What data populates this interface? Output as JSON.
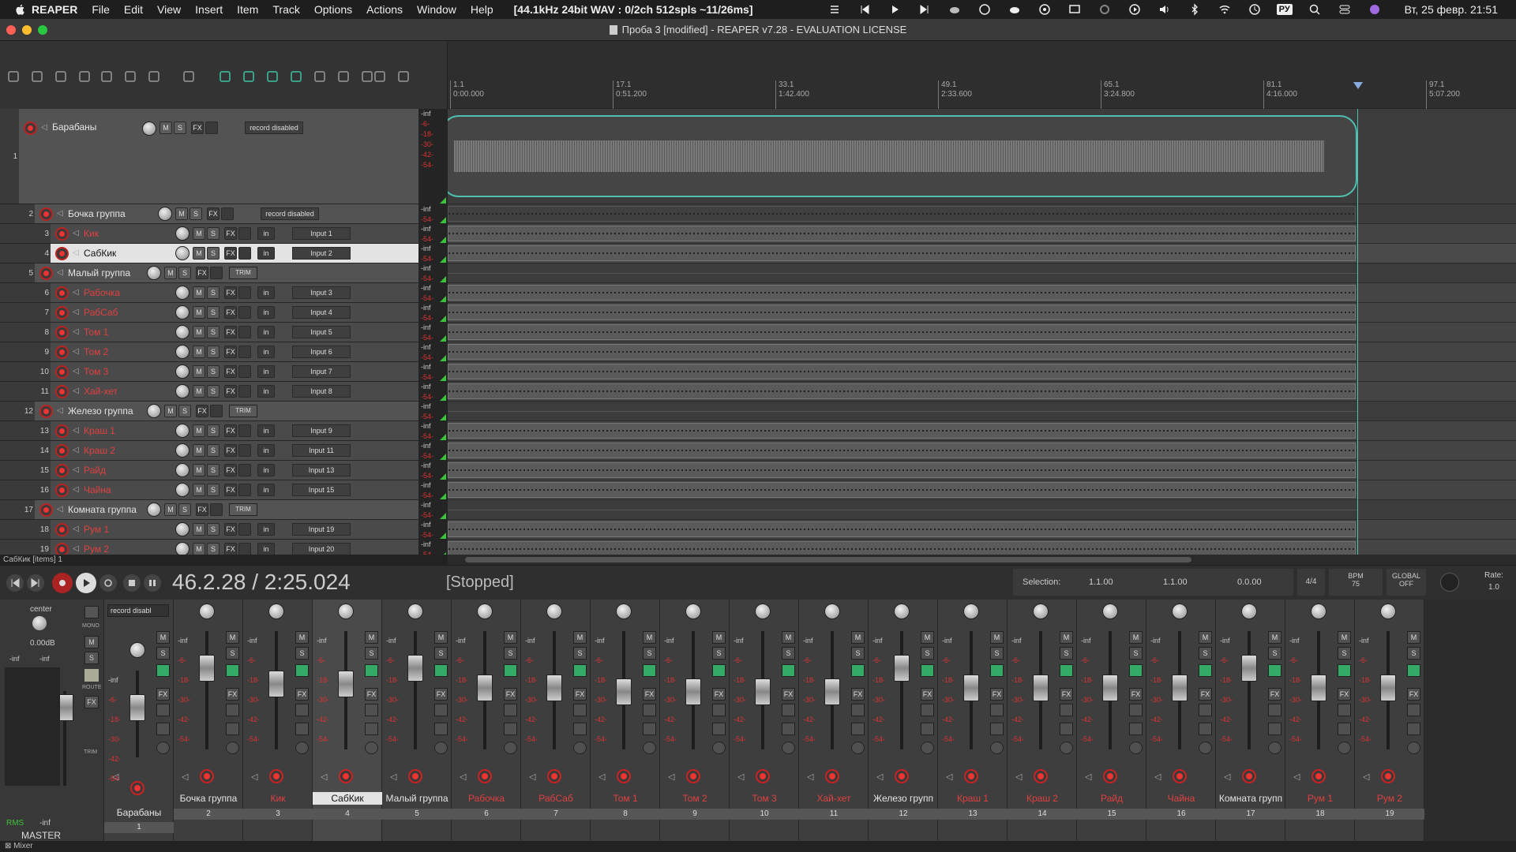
{
  "menubar": {
    "app": "REAPER",
    "items": [
      "File",
      "Edit",
      "View",
      "Insert",
      "Item",
      "Track",
      "Options",
      "Actions",
      "Window",
      "Help"
    ],
    "status": "[44.1kHz 24bit WAV : 0/2ch 512spls ~11/26ms]",
    "lang": "РУ",
    "clock": "Вт, 25 февр.  21:51"
  },
  "window": {
    "title": "Проба 3 [modified] - REAPER v7.28 - EVALUATION LICENSE"
  },
  "ruler": {
    "marks": [
      {
        "bar": "1.1",
        "time": "0:00.000"
      },
      {
        "bar": "17.1",
        "time": "0:51.200"
      },
      {
        "bar": "33.1",
        "time": "1:42.400"
      },
      {
        "bar": "49.1",
        "time": "2:33.600"
      },
      {
        "bar": "65.1",
        "time": "3:24.800"
      },
      {
        "bar": "81.1",
        "time": "4:16.000"
      },
      {
        "bar": "97.1",
        "time": "5:07.200"
      }
    ]
  },
  "tracks": [
    {
      "num": "1",
      "name": "Барабаны",
      "type": "folder",
      "input": "record disabled"
    },
    {
      "num": "2",
      "name": "Бочка группа",
      "type": "folder",
      "input": "record disabled"
    },
    {
      "num": "3",
      "name": "Кик",
      "type": "track",
      "input": "Input 1"
    },
    {
      "num": "4",
      "name": "СабКик",
      "type": "track",
      "input": "Input 2",
      "selected": true
    },
    {
      "num": "5",
      "name": "Малый группа",
      "type": "folder",
      "input": ""
    },
    {
      "num": "6",
      "name": "Рабочка",
      "type": "track",
      "input": "Input 3"
    },
    {
      "num": "7",
      "name": "РабСаб",
      "type": "track",
      "input": "Input 4"
    },
    {
      "num": "8",
      "name": "Том 1",
      "type": "track",
      "input": "Input 5"
    },
    {
      "num": "9",
      "name": "Том 2",
      "type": "track",
      "input": "Input 6"
    },
    {
      "num": "10",
      "name": "Том 3",
      "type": "track",
      "input": "Input 7"
    },
    {
      "num": "11",
      "name": "Хай-хет",
      "type": "track",
      "input": "Input 8"
    },
    {
      "num": "12",
      "name": "Железо группа",
      "type": "folder",
      "input": ""
    },
    {
      "num": "13",
      "name": "Краш 1",
      "type": "track",
      "input": "Input 9"
    },
    {
      "num": "14",
      "name": "Краш 2",
      "type": "track",
      "input": "Input 11"
    },
    {
      "num": "15",
      "name": "Райд",
      "type": "track",
      "input": "Input 13"
    },
    {
      "num": "16",
      "name": "Чайна",
      "type": "track",
      "input": "Input 15"
    },
    {
      "num": "17",
      "name": "Комната группа",
      "type": "folder",
      "input": ""
    },
    {
      "num": "18",
      "name": "Рум 1",
      "type": "track",
      "input": "Input 19"
    },
    {
      "num": "19",
      "name": "Рум 2",
      "type": "track",
      "input": "Input 20"
    }
  ],
  "labels": {
    "mute": "M",
    "solo": "S",
    "fx": "FX",
    "in": "in",
    "trim": "TRIM",
    "inf": "-inf",
    "m6": "-6-",
    "m18": "-18-",
    "m30": "-30-",
    "m42": "-42-",
    "m54": "-54-"
  },
  "statusline": "СабКик [items] 1",
  "transport": {
    "time": "46.2.28 / 2:25.024",
    "state": "[Stopped]",
    "selection_label": "Selection:",
    "sel_start": "1.1.00",
    "sel_end": "1.1.00",
    "sel_len": "0.0.00",
    "timesig": "4/4",
    "bpm_label": "BPM",
    "bpm": "75",
    "global_label": "GLOBAL",
    "global_value": "OFF",
    "rate_label": "Rate:",
    "rate": "1.0"
  },
  "mixer": {
    "master_label": "MASTER",
    "center": "center",
    "volume": "0.00dB",
    "rms": "RMS",
    "rms_val": "-inf",
    "mono": "MONO",
    "route": "ROUTE",
    "record_disabled": "record disabl",
    "footer": "Mixer",
    "strips": [
      {
        "name": "Барабаны",
        "num": "1",
        "type": "folder"
      },
      {
        "name": "Бочка группа",
        "num": "2",
        "type": "folder"
      },
      {
        "name": "Кик",
        "num": "3",
        "type": "track"
      },
      {
        "name": "СабКик",
        "num": "4",
        "type": "track",
        "selected": true
      },
      {
        "name": "Малый группа",
        "num": "5",
        "type": "folder"
      },
      {
        "name": "Рабочка",
        "num": "6",
        "type": "track"
      },
      {
        "name": "РабСаб",
        "num": "7",
        "type": "track"
      },
      {
        "name": "Том 1",
        "num": "8",
        "type": "track"
      },
      {
        "name": "Том 2",
        "num": "9",
        "type": "track"
      },
      {
        "name": "Том 3",
        "num": "10",
        "type": "track"
      },
      {
        "name": "Хай-хет",
        "num": "11",
        "type": "track"
      },
      {
        "name": "Железо групп",
        "num": "12",
        "type": "folder"
      },
      {
        "name": "Краш 1",
        "num": "13",
        "type": "track"
      },
      {
        "name": "Краш 2",
        "num": "14",
        "type": "track"
      },
      {
        "name": "Райд",
        "num": "15",
        "type": "track"
      },
      {
        "name": "Чайна",
        "num": "16",
        "type": "track"
      },
      {
        "name": "Комната групп",
        "num": "17",
        "type": "folder"
      },
      {
        "name": "Рум 1",
        "num": "18",
        "type": "track"
      },
      {
        "name": "Рум 2",
        "num": "19",
        "type": "track"
      }
    ]
  },
  "colors": {
    "accent": "#4fc0b0",
    "record": "#e33333",
    "track_name": "#e04040",
    "meter_green": "#3cc33c"
  }
}
